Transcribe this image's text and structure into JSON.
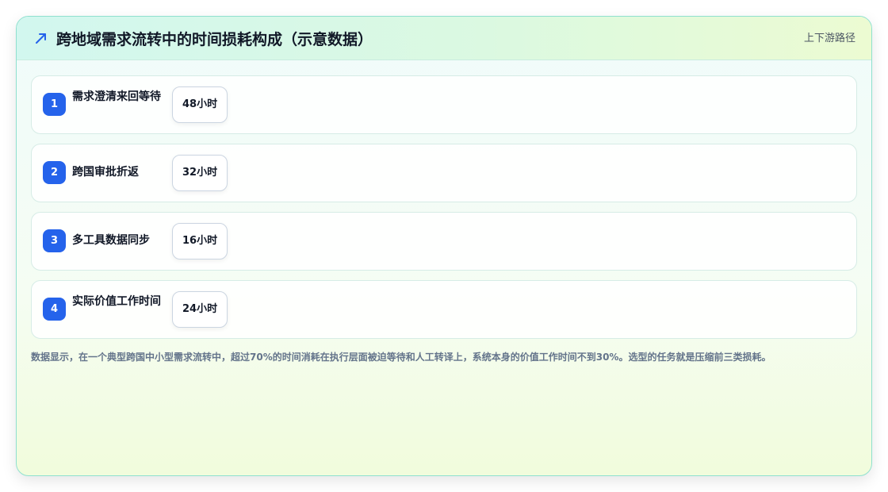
{
  "header": {
    "icon": "trend-arrow-icon",
    "title": "跨地域需求流转中的时间损耗构成（示意数据）",
    "tag": "上下游路径"
  },
  "items": [
    {
      "index": "1",
      "label": "需求澄清来回等待",
      "hours": "48小时"
    },
    {
      "index": "2",
      "label": "跨国审批折返",
      "hours": "32小时"
    },
    {
      "index": "3",
      "label": "多工具数据同步",
      "hours": "16小时"
    },
    {
      "index": "4",
      "label": "实际价值工作时间",
      "hours": "24小时"
    }
  ],
  "note": "数据显示，在一个典型跨国中小型需求流转中，超过70%的时间消耗在执行层面被迫等待和人工转译上，系统本身的价值工作时间不到30%。选型的任务就是压缩前三类损耗。",
  "colors": {
    "accent": "#2563eb",
    "border": "#8fe0cf"
  }
}
